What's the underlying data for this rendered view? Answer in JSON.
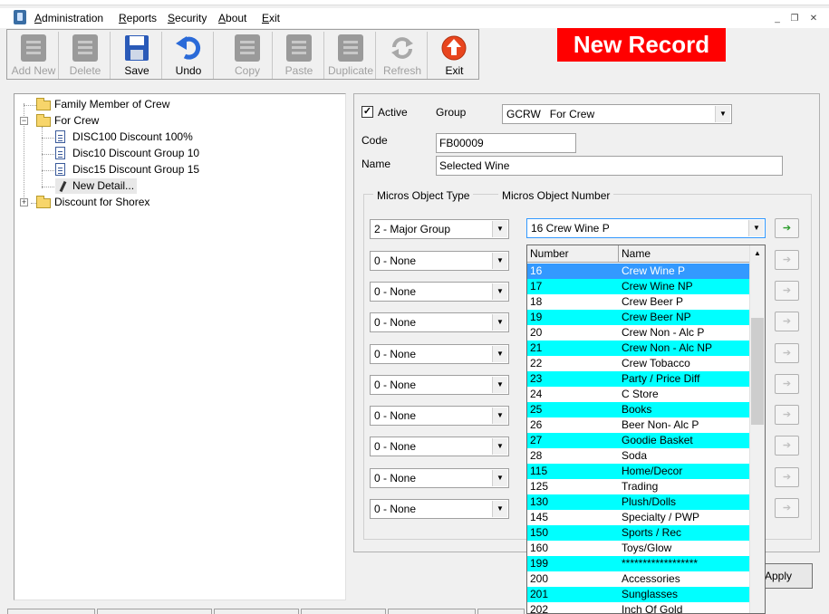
{
  "menu": {
    "items": [
      "Administration",
      "Reports",
      "Security",
      "About",
      "Exit"
    ]
  },
  "toolbar": {
    "buttons": [
      {
        "label": "Add New",
        "icon": "add-new-icon",
        "enabled": false
      },
      {
        "label": "Delete",
        "icon": "delete-icon",
        "enabled": false
      },
      {
        "label": "Save",
        "icon": "save-icon",
        "enabled": true
      },
      {
        "label": "Undo",
        "icon": "undo-icon",
        "enabled": true
      },
      {
        "label": "Copy",
        "icon": "copy-icon",
        "enabled": false
      },
      {
        "label": "Paste",
        "icon": "paste-icon",
        "enabled": false
      },
      {
        "label": "Duplicate",
        "icon": "duplicate-icon",
        "enabled": false
      },
      {
        "label": "Refresh",
        "icon": "refresh-icon",
        "enabled": false
      },
      {
        "label": "Exit",
        "icon": "exit-icon",
        "enabled": true
      }
    ]
  },
  "banner": {
    "text": "New Record",
    "color": "#ff0000"
  },
  "tree": {
    "nodes": [
      {
        "label": "Family Member of Crew",
        "type": "folder"
      },
      {
        "label": "For Crew",
        "type": "folder"
      },
      {
        "label": "DISC100 Discount 100%",
        "type": "page"
      },
      {
        "label": "Disc10 Discount Group 10",
        "type": "page"
      },
      {
        "label": "Disc15 Discount Group 15",
        "type": "page"
      },
      {
        "label": "New Detail...",
        "type": "pencil"
      },
      {
        "label": "Discount for Shorex",
        "type": "folder"
      }
    ]
  },
  "form": {
    "active_label": "Active",
    "active_checked": true,
    "group_label": "Group",
    "group_value": "GCRW   For Crew",
    "code_label": "Code",
    "code_value": "FB00009",
    "name_label": "Name",
    "name_value": "Selected Wine",
    "micros_type_label": "Micros Object Type",
    "micros_number_label": "Micros Object Number",
    "object_types": [
      "2 - Major Group",
      "0 - None",
      "0 - None",
      "0 - None",
      "0 - None",
      "0 - None",
      "0 - None",
      "0 - None",
      "0 - None",
      "0 - None"
    ],
    "object_number_selected": "16 Crew Wine P",
    "apply_label": "Apply"
  },
  "dropdown": {
    "headers": [
      "Number",
      "Name"
    ],
    "rows": [
      {
        "number": "16",
        "name": "Crew Wine P"
      },
      {
        "number": "17",
        "name": "Crew Wine NP"
      },
      {
        "number": "18",
        "name": "Crew Beer P"
      },
      {
        "number": "19",
        "name": "Crew Beer NP"
      },
      {
        "number": "20",
        "name": "Crew Non - Alc P"
      },
      {
        "number": "21",
        "name": "Crew Non - Alc NP"
      },
      {
        "number": "22",
        "name": "Crew Tobacco"
      },
      {
        "number": "23",
        "name": "Party / Price Diff"
      },
      {
        "number": "24",
        "name": "C Store"
      },
      {
        "number": "25",
        "name": "Books"
      },
      {
        "number": "26",
        "name": "Beer Non- Alc P"
      },
      {
        "number": "27",
        "name": "Goodie Basket"
      },
      {
        "number": "28",
        "name": "Soda"
      },
      {
        "number": "115",
        "name": "Home/Decor"
      },
      {
        "number": "125",
        "name": "Trading"
      },
      {
        "number": "130",
        "name": "Plush/Dolls"
      },
      {
        "number": "145",
        "name": "Specialty / PWP"
      },
      {
        "number": "150",
        "name": "Sports / Rec"
      },
      {
        "number": "160",
        "name": "Toys/Glow"
      },
      {
        "number": "199",
        "name": "******************"
      },
      {
        "number": "200",
        "name": "Accessories"
      },
      {
        "number": "201",
        "name": "Sunglasses"
      },
      {
        "number": "202",
        "name": "Inch Of Gold"
      }
    ],
    "alt_color": "#00ffff",
    "selected_color": "#3399ff"
  }
}
